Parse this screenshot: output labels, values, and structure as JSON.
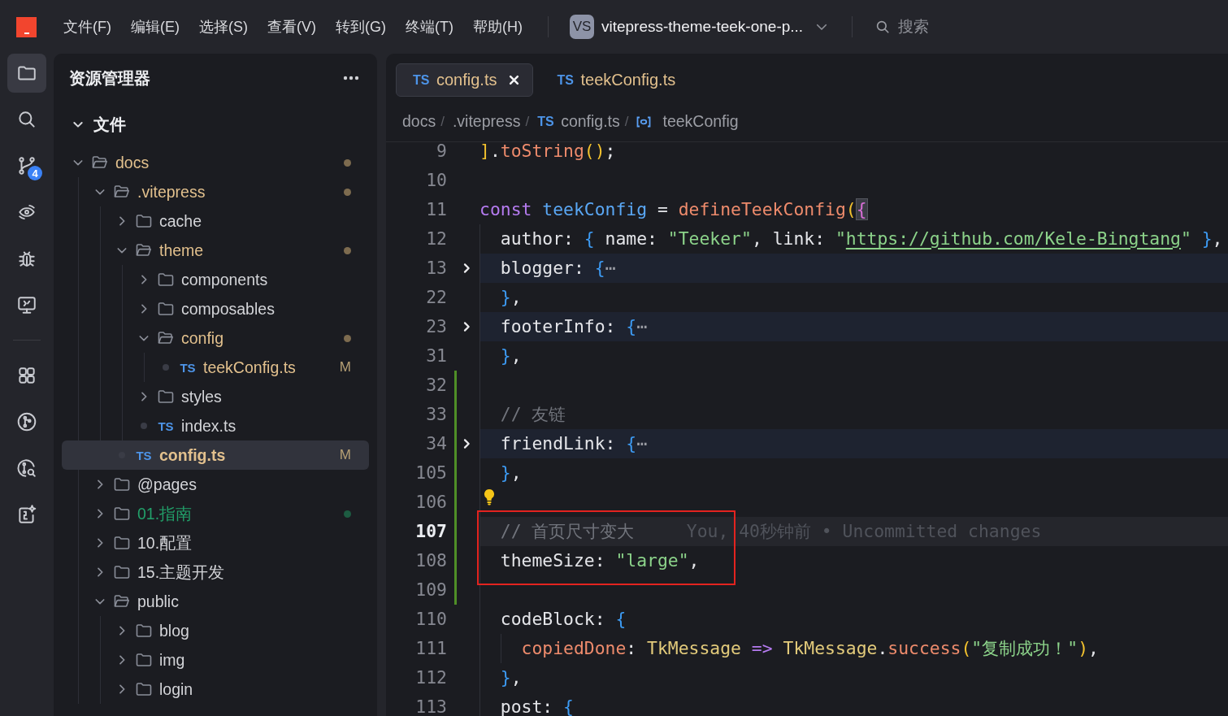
{
  "title_bar": {
    "menus": [
      "文件(F)",
      "编辑(E)",
      "选择(S)",
      "查看(V)",
      "转到(G)",
      "终端(T)",
      "帮助(H)"
    ],
    "workspace": {
      "badge": "VS",
      "name": "vitepress-theme-teek-one-p..."
    },
    "search": {
      "placeholder": "搜索"
    }
  },
  "activity_bar": {
    "groups": [
      {
        "items": [
          {
            "kind": "explorer",
            "selected": true
          },
          {
            "kind": "search",
            "selected": false
          },
          {
            "kind": "source-control",
            "selected": false,
            "badge": "4"
          },
          {
            "kind": "remote-explorer",
            "selected": false
          },
          {
            "kind": "debug",
            "selected": false
          },
          {
            "kind": "remote-display",
            "selected": false
          }
        ]
      },
      {
        "items": [
          {
            "kind": "extensions",
            "selected": false
          },
          {
            "kind": "git-graph",
            "selected": false
          },
          {
            "kind": "git-history",
            "selected": false
          },
          {
            "kind": "ai-assistant",
            "selected": false
          }
        ]
      }
    ]
  },
  "explorer": {
    "title": "资源管理器",
    "section": {
      "title": "文件",
      "expanded": true
    },
    "tree": [
      {
        "kind": "folder",
        "name": "docs",
        "expanded": true,
        "selected": false,
        "modified": true,
        "added": false,
        "children": [
          {
            "kind": "folder",
            "name": ".vitepress",
            "expanded": true,
            "selected": false,
            "modified": true,
            "added": false,
            "children": [
              {
                "kind": "folder",
                "name": "cache",
                "expanded": false,
                "selected": false,
                "modified": false,
                "added": false
              },
              {
                "kind": "folder",
                "name": "theme",
                "expanded": true,
                "selected": false,
                "modified": true,
                "added": false,
                "children": [
                  {
                    "kind": "folder",
                    "name": "components",
                    "expanded": false,
                    "selected": false,
                    "modified": false,
                    "added": false
                  },
                  {
                    "kind": "folder",
                    "name": "composables",
                    "expanded": false,
                    "selected": false,
                    "modified": false,
                    "added": false
                  },
                  {
                    "kind": "folder",
                    "name": "config",
                    "expanded": true,
                    "selected": false,
                    "modified": true,
                    "added": false,
                    "children": [
                      {
                        "kind": "file",
                        "lang": "TS",
                        "name": "teekConfig.ts",
                        "selected": false,
                        "modified": true,
                        "added": false,
                        "badge": "M"
                      }
                    ]
                  },
                  {
                    "kind": "folder",
                    "name": "styles",
                    "expanded": false,
                    "selected": false,
                    "modified": false,
                    "added": false
                  },
                  {
                    "kind": "file",
                    "lang": "TS",
                    "name": "index.ts",
                    "selected": false,
                    "modified": false,
                    "added": false
                  }
                ]
              },
              {
                "kind": "file",
                "lang": "TS",
                "name": "config.ts",
                "selected": true,
                "modified": true,
                "added": false,
                "badge": "M"
              }
            ]
          },
          {
            "kind": "folder",
            "name": "@pages",
            "expanded": false,
            "selected": false,
            "modified": false,
            "added": false
          },
          {
            "kind": "folder",
            "name": "01.指南",
            "expanded": false,
            "selected": false,
            "modified": false,
            "added": true
          },
          {
            "kind": "folder",
            "name": "10.配置",
            "expanded": false,
            "selected": false,
            "modified": false,
            "added": false
          },
          {
            "kind": "folder",
            "name": "15.主题开发",
            "expanded": false,
            "selected": false,
            "modified": false,
            "added": false
          },
          {
            "kind": "folder",
            "name": "public",
            "expanded": true,
            "selected": false,
            "modified": false,
            "added": false,
            "children": [
              {
                "kind": "folder",
                "name": "blog",
                "expanded": false,
                "selected": false,
                "modified": false,
                "added": false
              },
              {
                "kind": "folder",
                "name": "img",
                "expanded": false,
                "selected": false,
                "modified": false,
                "added": false
              },
              {
                "kind": "folder",
                "name": "login",
                "expanded": false,
                "selected": false,
                "modified": false,
                "added": false
              }
            ]
          }
        ]
      }
    ]
  },
  "editor": {
    "tabs": [
      {
        "lang": "TS",
        "label": "config.ts",
        "selected": true,
        "modified": true,
        "closable": true
      },
      {
        "lang": "TS",
        "label": "teekConfig.ts",
        "selected": false,
        "modified": true,
        "closable": false
      }
    ],
    "breadcrumbs": [
      {
        "kind": "folder",
        "label": "docs",
        "separator": "/"
      },
      {
        "kind": "folder",
        "label": ".vitepress",
        "separator": "/"
      },
      {
        "kind": "file",
        "lang": "TS",
        "label": "config.ts",
        "separator": "/"
      },
      {
        "kind": "symbol",
        "label": "teekConfig"
      }
    ],
    "lines": [
      {
        "number": "9",
        "tokens": [
          {
            "text": "]",
            "kind": "bracket1"
          },
          {
            "text": ".",
            "kind": "plain"
          },
          {
            "text": "toString",
            "kind": "method"
          },
          {
            "text": "()",
            "kind": "bracket1"
          },
          {
            "text": ";",
            "kind": "plain"
          }
        ],
        "folded": false,
        "current": false,
        "added": false,
        "lightbulb": false,
        "boxed": false
      },
      {
        "number": "10",
        "folded": false,
        "current": false,
        "added": false,
        "lightbulb": false,
        "boxed": false
      },
      {
        "number": "11",
        "tokens": [
          {
            "text": "const",
            "kind": "keyword"
          },
          {
            "text": " teekConfig",
            "kind": "variable"
          },
          {
            "text": " = ",
            "kind": "plain"
          },
          {
            "text": "defineTeekConfig",
            "kind": "method"
          },
          {
            "text": "(",
            "kind": "bracket1"
          },
          {
            "text": "{",
            "kind": "bracket2-match"
          }
        ],
        "folded": false,
        "current": false,
        "added": false,
        "lightbulb": false,
        "boxed": false
      },
      {
        "number": "12",
        "tokens": [
          {
            "text": "  author: ",
            "kind": "plain"
          },
          {
            "text": "{",
            "kind": "bracket3"
          },
          {
            "text": " name: ",
            "kind": "plain"
          },
          {
            "text": "\"Teeker\"",
            "kind": "string"
          },
          {
            "text": ", link: ",
            "kind": "plain"
          },
          {
            "text": "\"",
            "kind": "string"
          },
          {
            "text": "https://github.com/Kele-Bingtang",
            "kind": "link"
          },
          {
            "text": "\"",
            "kind": "string"
          },
          {
            "text": " }",
            "kind": "bracket3"
          },
          {
            "text": ",",
            "kind": "plain"
          }
        ],
        "folded": false,
        "current": false,
        "added": false,
        "lightbulb": false,
        "boxed": false
      },
      {
        "number": "13",
        "tokens": [
          {
            "text": "  blogger: ",
            "kind": "plain"
          },
          {
            "text": "{",
            "kind": "bracket3"
          },
          {
            "text": "⋯",
            "kind": "ellipsis"
          }
        ],
        "folded": true,
        "current": false,
        "added": false,
        "lightbulb": false,
        "boxed": false
      },
      {
        "number": "22",
        "tokens": [
          {
            "text": "  }",
            "kind": "bracket3"
          },
          {
            "text": ",",
            "kind": "plain"
          }
        ],
        "folded": false,
        "current": false,
        "added": false,
        "lightbulb": false,
        "boxed": false
      },
      {
        "number": "23",
        "tokens": [
          {
            "text": "  footerInfo: ",
            "kind": "plain"
          },
          {
            "text": "{",
            "kind": "bracket3"
          },
          {
            "text": "⋯",
            "kind": "ellipsis"
          }
        ],
        "folded": true,
        "current": false,
        "added": false,
        "lightbulb": false,
        "boxed": false
      },
      {
        "number": "31",
        "tokens": [
          {
            "text": "  }",
            "kind": "bracket3"
          },
          {
            "text": ",",
            "kind": "plain"
          }
        ],
        "folded": false,
        "current": false,
        "added": false,
        "lightbulb": false,
        "boxed": false
      },
      {
        "number": "32",
        "folded": false,
        "current": false,
        "added": true,
        "lightbulb": false,
        "boxed": false
      },
      {
        "number": "33",
        "tokens": [
          {
            "text": "  // 友链",
            "kind": "comment"
          }
        ],
        "folded": false,
        "current": false,
        "added": true,
        "lightbulb": false,
        "boxed": false
      },
      {
        "number": "34",
        "tokens": [
          {
            "text": "  friendLink: ",
            "kind": "plain"
          },
          {
            "text": "{",
            "kind": "bracket3"
          },
          {
            "text": "⋯",
            "kind": "ellipsis"
          }
        ],
        "folded": true,
        "current": false,
        "added": true,
        "lightbulb": false,
        "boxed": false
      },
      {
        "number": "105",
        "tokens": [
          {
            "text": "  }",
            "kind": "bracket3"
          },
          {
            "text": ",",
            "kind": "plain"
          }
        ],
        "folded": false,
        "current": false,
        "added": true,
        "lightbulb": false,
        "boxed": false
      },
      {
        "number": "106",
        "folded": false,
        "current": false,
        "added": true,
        "lightbulb": true,
        "boxed": false
      },
      {
        "number": "107",
        "tokens": [
          {
            "text": "  // 首页尺寸变大",
            "kind": "comment"
          }
        ],
        "blame": "You, 40秒钟前 • Uncommitted changes",
        "folded": false,
        "current": true,
        "added": true,
        "lightbulb": false,
        "boxed": true
      },
      {
        "number": "108",
        "tokens": [
          {
            "text": "  themeSize: ",
            "kind": "plain"
          },
          {
            "text": "\"large\"",
            "kind": "string"
          },
          {
            "text": ",",
            "kind": "plain"
          }
        ],
        "folded": false,
        "current": false,
        "added": true,
        "lightbulb": false,
        "boxed": true
      },
      {
        "number": "109",
        "folded": false,
        "current": false,
        "added": true,
        "lightbulb": false,
        "boxed": false
      },
      {
        "number": "110",
        "tokens": [
          {
            "text": "  codeBlock: ",
            "kind": "plain"
          },
          {
            "text": "{",
            "kind": "bracket3"
          }
        ],
        "folded": false,
        "current": false,
        "added": false,
        "lightbulb": false,
        "boxed": false
      },
      {
        "number": "111",
        "tokens": [
          {
            "text": "    copiedDone",
            "kind": "method"
          },
          {
            "text": ": ",
            "kind": "plain"
          },
          {
            "text": "TkMessage",
            "kind": "type"
          },
          {
            "text": " =>",
            "kind": "keyword"
          },
          {
            "text": " TkMessage",
            "kind": "type"
          },
          {
            "text": ".",
            "kind": "plain"
          },
          {
            "text": "success",
            "kind": "method"
          },
          {
            "text": "(",
            "kind": "bracket1"
          },
          {
            "text": "\"复制成功！\"",
            "kind": "string"
          },
          {
            "text": ")",
            "kind": "bracket1"
          },
          {
            "text": ",",
            "kind": "plain"
          }
        ],
        "folded": false,
        "current": false,
        "added": false,
        "lightbulb": false,
        "boxed": false
      },
      {
        "number": "112",
        "tokens": [
          {
            "text": "  }",
            "kind": "bracket3"
          },
          {
            "text": ",",
            "kind": "plain"
          }
        ],
        "folded": false,
        "current": false,
        "added": false,
        "lightbulb": false,
        "boxed": false
      },
      {
        "number": "113",
        "tokens": [
          {
            "text": "  post: ",
            "kind": "plain"
          },
          {
            "text": "{",
            "kind": "bracket3"
          }
        ],
        "folded": false,
        "current": false,
        "added": false,
        "lightbulb": false,
        "boxed": false
      }
    ]
  }
}
